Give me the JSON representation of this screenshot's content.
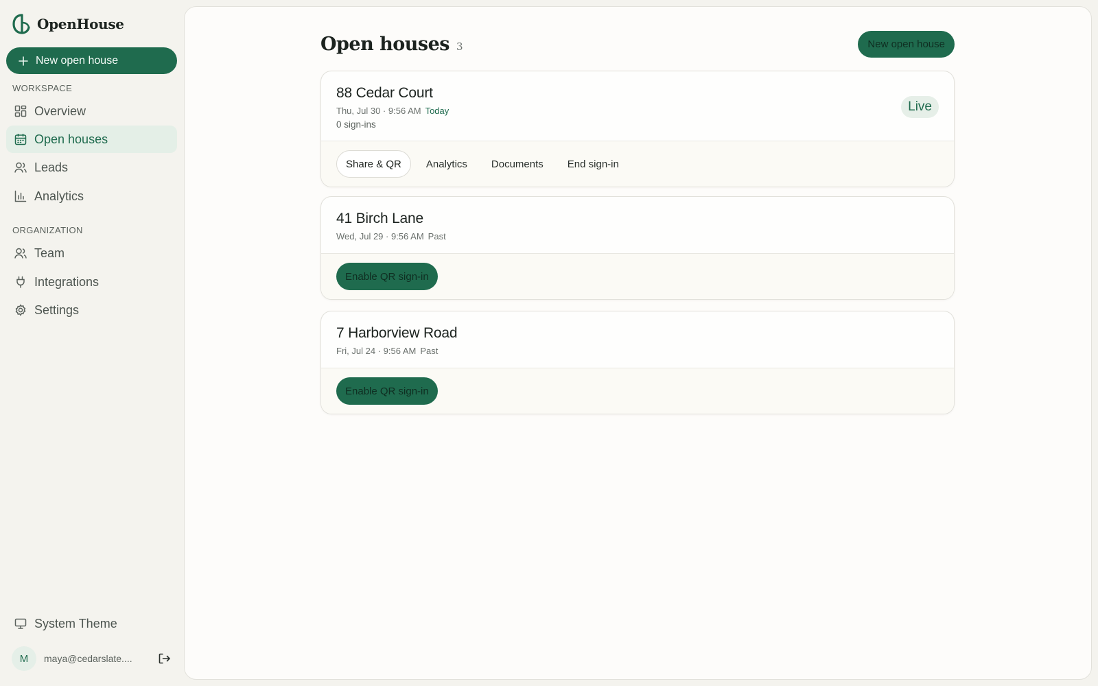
{
  "brand": {
    "name": "OpenHouse",
    "logo_icon": "openhouse-logo-icon"
  },
  "sidebar": {
    "new_button_label": "New open house",
    "workspace_label": "WORKSPACE",
    "workspace_items": [
      {
        "label": "Overview",
        "icon": "grid-icon"
      },
      {
        "label": "Open houses",
        "icon": "calendar-icon",
        "active": true
      },
      {
        "label": "Leads",
        "icon": "users-icon"
      },
      {
        "label": "Analytics",
        "icon": "bar-chart-icon"
      }
    ],
    "organization_label": "ORGANIZATION",
    "organization_items": [
      {
        "label": "Team",
        "icon": "users-icon"
      },
      {
        "label": "Integrations",
        "icon": "plug-icon"
      },
      {
        "label": "Settings",
        "icon": "gear-icon"
      }
    ],
    "theme_label": "System Theme",
    "user": {
      "initial": "M",
      "email": "maya@cedarslate...."
    }
  },
  "main": {
    "title": "Open houses",
    "count": "3",
    "new_button_label": "New open house",
    "listings": [
      {
        "address": "88 Cedar Court",
        "date": "Thu, Jul 30 · 9:56 AM",
        "status": "Today",
        "signins": "0 sign-ins",
        "badge": "Live",
        "actions": [
          "Share & QR",
          "Analytics",
          "Documents",
          "End sign-in"
        ]
      },
      {
        "address": "41 Birch Lane",
        "date": "Wed, Jul 29 · 9:56 AM",
        "status": "Past",
        "action": "Enable QR sign-in"
      },
      {
        "address": "7 Harborview Road",
        "date": "Fri, Jul 24 · 9:56 AM",
        "status": "Past",
        "action": "Enable QR sign-in"
      }
    ]
  },
  "colors": {
    "accent": "#1f6b4e",
    "accent_soft": "#e4efe7",
    "sidebar_bg": "#f4f3ee",
    "panel_bg": "#fdfcfa"
  }
}
